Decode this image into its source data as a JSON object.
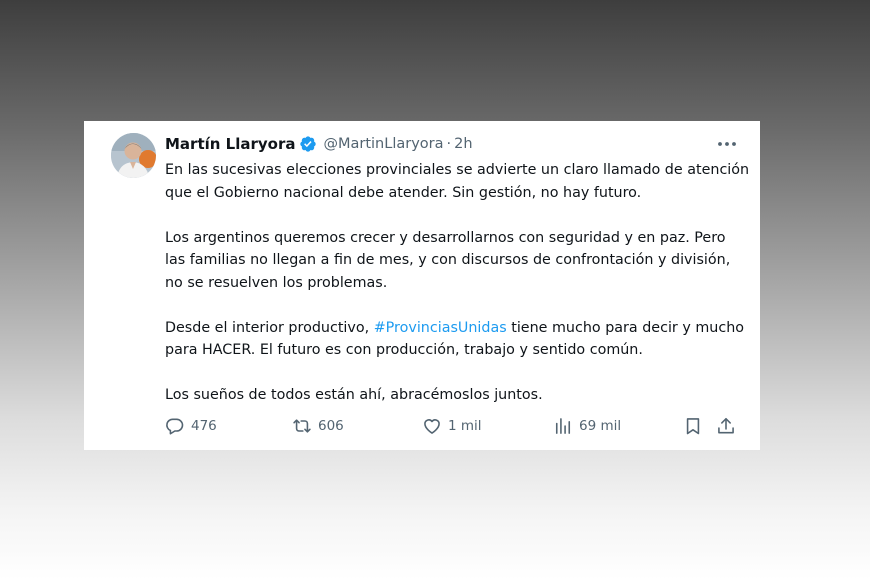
{
  "tweet": {
    "author_name": "Martín Llaryora",
    "handle": "@MartinLlaryora",
    "separator": "·",
    "time": "2h",
    "paragraphs": [
      "En las sucesivas elecciones provinciales se advierte un claro llamado de atención que el Gobierno nacional debe atender. Sin gestión, no hay futuro.",
      "Los argentinos queremos crecer y desarrollarnos con seguridad y en paz. Pero las familias no llegan a fin de mes, y con discursos de confrontación y división, no se resuelven los problemas."
    ],
    "paragraph3_before": "Desde el interior productivo, ",
    "hashtag": "#ProvinciasUnidas",
    "paragraph3_after": " tiene mucho para decir y mucho para HACER. El futuro es con producción, trabajo y sentido común.",
    "paragraph4": "Los sueños de todos están ahí, abracémoslos juntos.",
    "stats": {
      "replies": "476",
      "retweets": "606",
      "likes": "1 mil",
      "views": "69 mil"
    }
  },
  "icons": {
    "verified": "verified-badge-icon",
    "more": "more-options-icon",
    "reply": "reply-icon",
    "retweet": "retweet-icon",
    "like": "heart-icon",
    "views": "views-chart-icon",
    "bookmark": "bookmark-icon",
    "share": "share-icon"
  },
  "colors": {
    "text": "#0f1419",
    "secondary": "#536471",
    "accent": "#1d9bf0"
  }
}
